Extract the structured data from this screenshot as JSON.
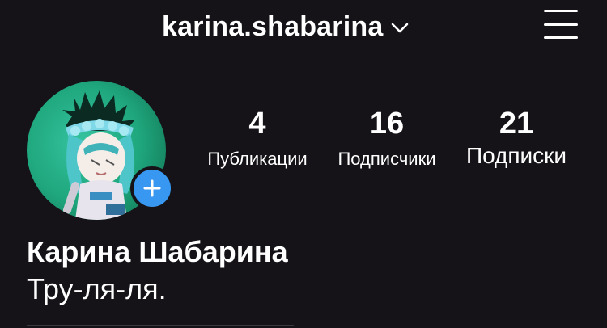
{
  "header": {
    "username": "karina.shabarina",
    "username_icon": "chevron-down-icon",
    "menu_icon": "hamburger-menu-icon"
  },
  "profile": {
    "avatar_icon": "profile-avatar",
    "add_story_icon": "plus-icon",
    "accent_color": "#3897f0",
    "background_color": "#151318",
    "stats": [
      {
        "value": "4",
        "label": "Публикации"
      },
      {
        "value": "16",
        "label": "Подписчики"
      },
      {
        "value": "21",
        "label": "Подписки"
      }
    ],
    "full_name": "Карина Шабарина",
    "bio": "Тру-ля-ля."
  }
}
